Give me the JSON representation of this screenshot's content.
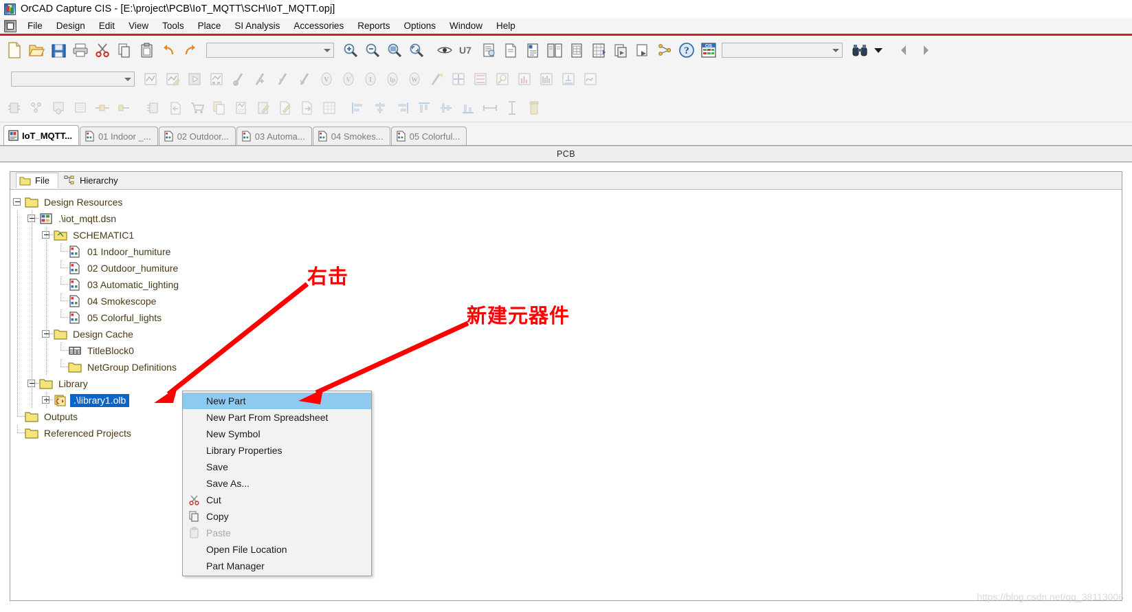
{
  "window": {
    "title": "OrCAD Capture CIS - [E:\\project\\PCB\\IoT_MQTT\\SCH\\IoT_MQTT.opj]",
    "app_icon": "orcad-capture-icon"
  },
  "menubar": {
    "system_icon": "system-menu-icon",
    "items": [
      {
        "label": "File"
      },
      {
        "label": "Design"
      },
      {
        "label": "Edit"
      },
      {
        "label": "View"
      },
      {
        "label": "Tools"
      },
      {
        "label": "Place"
      },
      {
        "label": "SI Analysis"
      },
      {
        "label": "Accessories"
      },
      {
        "label": "Reports"
      },
      {
        "label": "Options"
      },
      {
        "label": "Window"
      },
      {
        "label": "Help"
      }
    ]
  },
  "toolbars": {
    "row1": {
      "icons_left": [
        {
          "name": "new-file-icon"
        },
        {
          "name": "open-folder-icon"
        },
        {
          "name": "save-icon"
        },
        {
          "name": "print-icon"
        },
        {
          "name": "cut-scissors-icon"
        },
        {
          "name": "copy-icon"
        },
        {
          "name": "paste-icon"
        },
        {
          "name": "undo-icon"
        },
        {
          "name": "redo-icon"
        }
      ],
      "zoom_combo_value": "",
      "icons_mid": [
        {
          "name": "zoom-in-icon"
        },
        {
          "name": "zoom-out-icon"
        },
        {
          "name": "zoom-area-icon"
        },
        {
          "name": "zoom-fit-icon"
        },
        {
          "name": "eye-visibility-icon"
        },
        {
          "name": "annotate-u7-icon"
        },
        {
          "name": "back-annotate-icon"
        },
        {
          "name": "design-rules-check-icon"
        },
        {
          "name": "create-netlist-icon"
        },
        {
          "name": "cross-reference-icon"
        },
        {
          "name": "bill-of-materials-icon"
        },
        {
          "name": "export-properties-icon"
        },
        {
          "name": "import-properties-icon"
        },
        {
          "name": "snap-to-grid-icon"
        },
        {
          "name": "part-manager-icon"
        },
        {
          "name": "help-question-icon"
        },
        {
          "name": "cis-explorer-icon"
        }
      ],
      "search_combo_value": "",
      "search_icon": "binoculars-find-icon",
      "search_dropdown_icon": "chevron-down-icon"
    },
    "row2": {
      "combo_value": "",
      "icons": [
        {
          "name": "new-simulation-profile-icon"
        },
        {
          "name": "edit-simulation-profile-icon"
        },
        {
          "name": "run-simulation-icon"
        },
        {
          "name": "view-simulation-results-icon"
        },
        {
          "name": "voltage-marker-icon"
        },
        {
          "name": "voltage-differential-marker-icon"
        },
        {
          "name": "current-marker-icon"
        },
        {
          "name": "power-marker-icon"
        },
        {
          "name": "voltage-level-marker-icon"
        },
        {
          "name": "voltage-db-marker-icon"
        },
        {
          "name": "current-level-marker-icon"
        },
        {
          "name": "current-phase-marker-icon"
        },
        {
          "name": "power-w-marker-icon"
        },
        {
          "name": "advanced-marker-icon"
        },
        {
          "name": "place-net-alias-icon"
        },
        {
          "name": "place-bus-entry-icon"
        },
        {
          "name": "probe-settings-icon"
        },
        {
          "name": "bar-plot-icon"
        },
        {
          "name": "histogram-icon"
        },
        {
          "name": "trace-add-icon"
        },
        {
          "name": "waveform-icon"
        }
      ]
    },
    "row3": {
      "icons": [
        {
          "name": "place-part-icon"
        },
        {
          "name": "place-part-group-icon"
        },
        {
          "name": "place-database-part-icon"
        },
        {
          "name": "place-ground-icon"
        },
        {
          "name": "place-power-icon"
        },
        {
          "name": "place-port-icon"
        },
        {
          "name": "place-hierarchical-block-icon"
        },
        {
          "name": "import-part-icon"
        },
        {
          "name": "cart-order-parts-icon"
        },
        {
          "name": "copy-part-properties-icon"
        },
        {
          "name": "edit-part-properties-icon"
        },
        {
          "name": "edit-part-icon"
        },
        {
          "name": "edit-notes-icon"
        },
        {
          "name": "export-part-icon"
        },
        {
          "name": "spreadsheet-view-icon"
        },
        {
          "name": "align-left-icon"
        },
        {
          "name": "align-center-horizontal-icon"
        },
        {
          "name": "align-right-icon"
        },
        {
          "name": "align-top-icon"
        },
        {
          "name": "align-center-vertical-icon"
        },
        {
          "name": "align-bottom-icon"
        },
        {
          "name": "distribute-horizontally-icon"
        },
        {
          "name": "distribute-vertically-icon"
        },
        {
          "name": "delete-icon"
        }
      ]
    }
  },
  "doc_tabs": [
    {
      "label": "IoT_MQTT...",
      "icon": "project-file-icon",
      "active": true
    },
    {
      "label": "01 Indoor _...",
      "icon": "schematic-page-icon",
      "active": false
    },
    {
      "label": "02 Outdoor...",
      "icon": "schematic-page-icon",
      "active": false
    },
    {
      "label": "03 Automa...",
      "icon": "schematic-page-icon",
      "active": false
    },
    {
      "label": "04 Smokes...",
      "icon": "schematic-page-icon",
      "active": false
    },
    {
      "label": "05 Colorful...",
      "icon": "schematic-page-icon",
      "active": false
    }
  ],
  "pcb_caption": "PCB",
  "panel": {
    "tabs": [
      {
        "label": "File",
        "icon": "folder-icon",
        "selected": true
      },
      {
        "label": "Hierarchy",
        "icon": "hierarchy-tree-icon",
        "selected": false
      }
    ],
    "tree": [
      {
        "label": "Design Resources",
        "depth": 0,
        "icon": "folder-icon",
        "expander": "minus",
        "selected": false
      },
      {
        "label": ".\\iot_mqtt.dsn",
        "depth": 1,
        "icon": "design-file-icon",
        "expander": "minus",
        "selected": false
      },
      {
        "label": "SCHEMATIC1",
        "depth": 2,
        "icon": "folder-schematic-icon",
        "expander": "minus",
        "selected": false
      },
      {
        "label": "01 Indoor_humiture",
        "depth": 3,
        "icon": "schematic-page-icon",
        "expander": "leaf",
        "selected": false
      },
      {
        "label": "02 Outdoor_humiture",
        "depth": 3,
        "icon": "schematic-page-icon",
        "expander": "leaf",
        "selected": false
      },
      {
        "label": "03 Automatic_lighting",
        "depth": 3,
        "icon": "schematic-page-icon",
        "expander": "leaf",
        "selected": false
      },
      {
        "label": "04 Smokescope",
        "depth": 3,
        "icon": "schematic-page-icon",
        "expander": "leaf",
        "selected": false
      },
      {
        "label": "05 Colorful_lights",
        "depth": 3,
        "icon": "schematic-page-icon",
        "expander": "leaf",
        "selected": false
      },
      {
        "label": "Design Cache",
        "depth": 2,
        "icon": "folder-icon",
        "expander": "minus",
        "selected": false
      },
      {
        "label": "TitleBlock0",
        "depth": 3,
        "icon": "titleblock-icon",
        "expander": "leaf",
        "selected": false
      },
      {
        "label": "NetGroup Definitions",
        "depth": 3,
        "icon": "folder-icon",
        "expander": "leaf",
        "selected": false
      },
      {
        "label": "Library",
        "depth": 1,
        "icon": "folder-icon",
        "expander": "minus",
        "selected": false
      },
      {
        "label": ".\\library1.olb",
        "depth": 2,
        "icon": "library-file-icon",
        "expander": "plus",
        "selected": true
      },
      {
        "label": "Outputs",
        "depth": 0,
        "icon": "folder-icon",
        "expander": "leaf",
        "selected": false
      },
      {
        "label": "Referenced Projects",
        "depth": 0,
        "icon": "folder-icon",
        "expander": "leaf",
        "selected": false
      }
    ]
  },
  "context_menu": {
    "items": [
      {
        "label": "New Part",
        "icon": null,
        "highlighted": true,
        "disabled": false
      },
      {
        "label": "New Part From Spreadsheet",
        "icon": null,
        "highlighted": false,
        "disabled": false
      },
      {
        "label": "New Symbol",
        "icon": null,
        "highlighted": false,
        "disabled": false
      },
      {
        "label": "Library Properties",
        "icon": null,
        "highlighted": false,
        "disabled": false
      },
      {
        "label": "Save",
        "icon": null,
        "highlighted": false,
        "disabled": false
      },
      {
        "label": "Save As...",
        "icon": null,
        "highlighted": false,
        "disabled": false
      },
      {
        "label": "Cut",
        "icon": "cut-scissors-icon",
        "highlighted": false,
        "disabled": false
      },
      {
        "label": "Copy",
        "icon": "copy-icon",
        "highlighted": false,
        "disabled": false
      },
      {
        "label": "Paste",
        "icon": "paste-icon",
        "highlighted": false,
        "disabled": true
      },
      {
        "label": "Open File Location",
        "icon": null,
        "highlighted": false,
        "disabled": false
      },
      {
        "label": "Part Manager",
        "icon": null,
        "highlighted": false,
        "disabled": false
      }
    ]
  },
  "annotations": [
    {
      "text": "右击",
      "color": "#ff0000"
    },
    {
      "text": "新建元器件",
      "color": "#ff0000"
    }
  ],
  "watermark": "https://blog.csdn.net/qq_38113006",
  "colors": {
    "menubar_underline": "#cf2020",
    "selection_blue": "#0a64c8",
    "menu_highlight": "#8ecaf0",
    "annotation_red": "#ff0000",
    "tree_text": "#4a3a14"
  }
}
